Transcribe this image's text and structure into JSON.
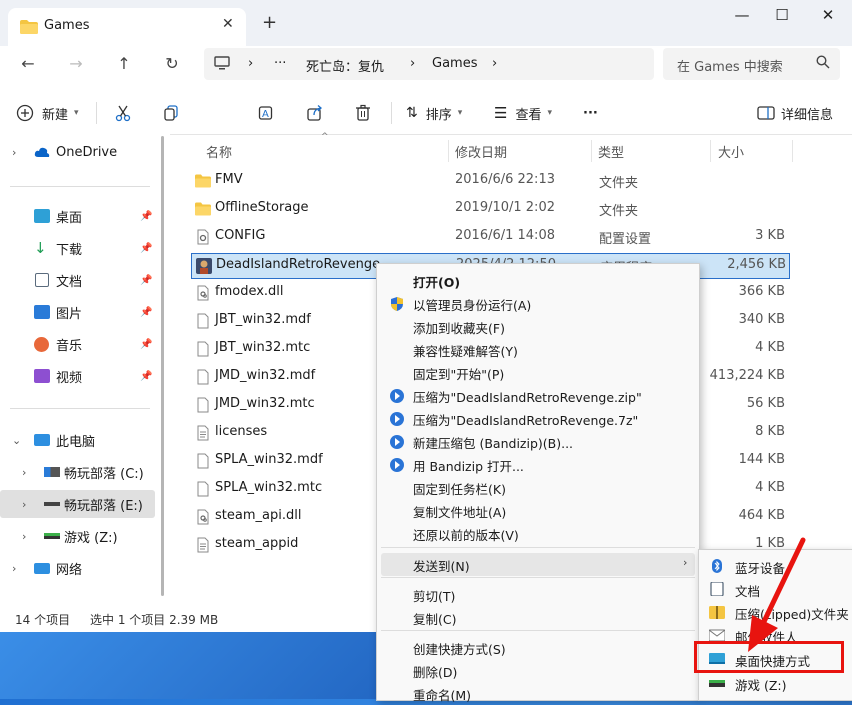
{
  "window": {
    "tab_title": "Games",
    "new_tab": "+",
    "controls": {
      "minimize": "—",
      "maximize": "☐",
      "close": "✕"
    }
  },
  "address": {
    "more": "···",
    "crumbs": [
      "死亡岛：复仇",
      "Games"
    ],
    "search_placeholder": "在 Games 中搜索"
  },
  "toolbar": {
    "new_label": "新建",
    "sort_label": "排序",
    "view_label": "查看",
    "more_label": "···",
    "details_label": "详细信息"
  },
  "sidebar": {
    "onedrive": "OneDrive",
    "quick": [
      {
        "label": "桌面",
        "icon": "desktop-icon"
      },
      {
        "label": "下载",
        "icon": "download-icon"
      },
      {
        "label": "文档",
        "icon": "document-icon"
      },
      {
        "label": "图片",
        "icon": "picture-icon"
      },
      {
        "label": "音乐",
        "icon": "music-icon"
      },
      {
        "label": "视频",
        "icon": "video-icon"
      }
    ],
    "thispc": "此电脑",
    "drives": [
      {
        "label": "畅玩部落 (C:)",
        "icon": "drive-c-icon"
      },
      {
        "label": "畅玩部落 (E:)",
        "icon": "drive-e-icon"
      },
      {
        "label": "游戏 (Z:)",
        "icon": "drive-z-icon"
      }
    ],
    "network": "网络"
  },
  "columns": {
    "name": "名称",
    "date": "修改日期",
    "type": "类型",
    "size": "大小"
  },
  "files": [
    {
      "name": "FMV",
      "date": "2016/6/6 22:13",
      "type": "文件夹",
      "size": "",
      "kind": "folder"
    },
    {
      "name": "OfflineStorage",
      "date": "2019/10/1 2:02",
      "type": "文件夹",
      "size": "",
      "kind": "folder"
    },
    {
      "name": "CONFIG",
      "date": "2016/6/1 14:08",
      "type": "配置设置",
      "size": "3 KB",
      "kind": "config"
    },
    {
      "name": "DeadIslandRetroRevenge",
      "date": "2025/4/2 12:50",
      "type": "应用程序",
      "size": "2,456 KB",
      "kind": "exe"
    },
    {
      "name": "fmodex.dll",
      "date": "",
      "type": "",
      "size": "366 KB",
      "kind": "dll"
    },
    {
      "name": "JBT_win32.mdf",
      "date": "",
      "type": "",
      "size": "340 KB",
      "kind": "file"
    },
    {
      "name": "JBT_win32.mtc",
      "date": "",
      "type": "",
      "size": "4 KB",
      "kind": "file"
    },
    {
      "name": "JMD_win32.mdf",
      "date": "",
      "type": "",
      "size": "413,224 KB",
      "kind": "file"
    },
    {
      "name": "JMD_win32.mtc",
      "date": "",
      "type": "",
      "size": "56 KB",
      "kind": "file"
    },
    {
      "name": "licenses",
      "date": "",
      "type": "",
      "size": "8 KB",
      "kind": "text"
    },
    {
      "name": "SPLA_win32.mdf",
      "date": "",
      "type": "",
      "size": "144 KB",
      "kind": "file"
    },
    {
      "name": "SPLA_win32.mtc",
      "date": "",
      "type": "",
      "size": "4 KB",
      "kind": "file"
    },
    {
      "name": "steam_api.dll",
      "date": "",
      "type": "",
      "size": "464 KB",
      "kind": "dll"
    },
    {
      "name": "steam_appid",
      "date": "",
      "type": "",
      "size": "1 KB",
      "kind": "text"
    }
  ],
  "status": {
    "count": "14 个项目",
    "selection": "选中 1 个项目  2.39 MB"
  },
  "context_menu": {
    "items": [
      {
        "label": "打开(O)",
        "icon": ""
      },
      {
        "label": "以管理员身份运行(A)",
        "icon": "shield-icon"
      },
      {
        "label": "添加到收藏夹(F)",
        "icon": ""
      },
      {
        "label": "兼容性疑难解答(Y)",
        "icon": ""
      },
      {
        "label": "固定到\"开始\"(P)",
        "icon": ""
      },
      {
        "label": "压缩为\"DeadIslandRetroRevenge.zip\"",
        "icon": "bandizip-icon"
      },
      {
        "label": "压缩为\"DeadIslandRetroRevenge.7z\"",
        "icon": "bandizip-icon"
      },
      {
        "label": "新建压缩包 (Bandizip)(B)...",
        "icon": "bandizip-icon"
      },
      {
        "label": "用 Bandizip 打开...",
        "icon": "bandizip-icon"
      },
      {
        "label": "固定到任务栏(K)",
        "icon": ""
      },
      {
        "label": "复制文件地址(A)",
        "icon": ""
      },
      {
        "label": "还原以前的版本(V)",
        "icon": ""
      },
      {
        "label": "发送到(N)",
        "icon": ""
      },
      {
        "label": "剪切(T)",
        "icon": ""
      },
      {
        "label": "复制(C)",
        "icon": ""
      },
      {
        "label": "创建快捷方式(S)",
        "icon": ""
      },
      {
        "label": "删除(D)",
        "icon": ""
      },
      {
        "label": "重命名(M)",
        "icon": ""
      }
    ],
    "submenu_arrow": "›"
  },
  "send_to": {
    "items": [
      {
        "label": "蓝牙设备",
        "icon": "bluetooth-icon"
      },
      {
        "label": "文档",
        "icon": "document-icon"
      },
      {
        "label": "压缩(zipped)文件夹",
        "icon": "zip-folder-icon"
      },
      {
        "label": "邮件收件人",
        "icon": "mail-icon"
      },
      {
        "label": "桌面快捷方式",
        "icon": "desktop-shortcut-icon"
      },
      {
        "label": "游戏 (Z:)",
        "icon": "drive-z-icon"
      }
    ]
  },
  "colors": {
    "selection_bg": "#cce4f7",
    "selection_border": "#2a6fc9",
    "annotation_red": "#e8140f",
    "accent": "#0067c0"
  }
}
